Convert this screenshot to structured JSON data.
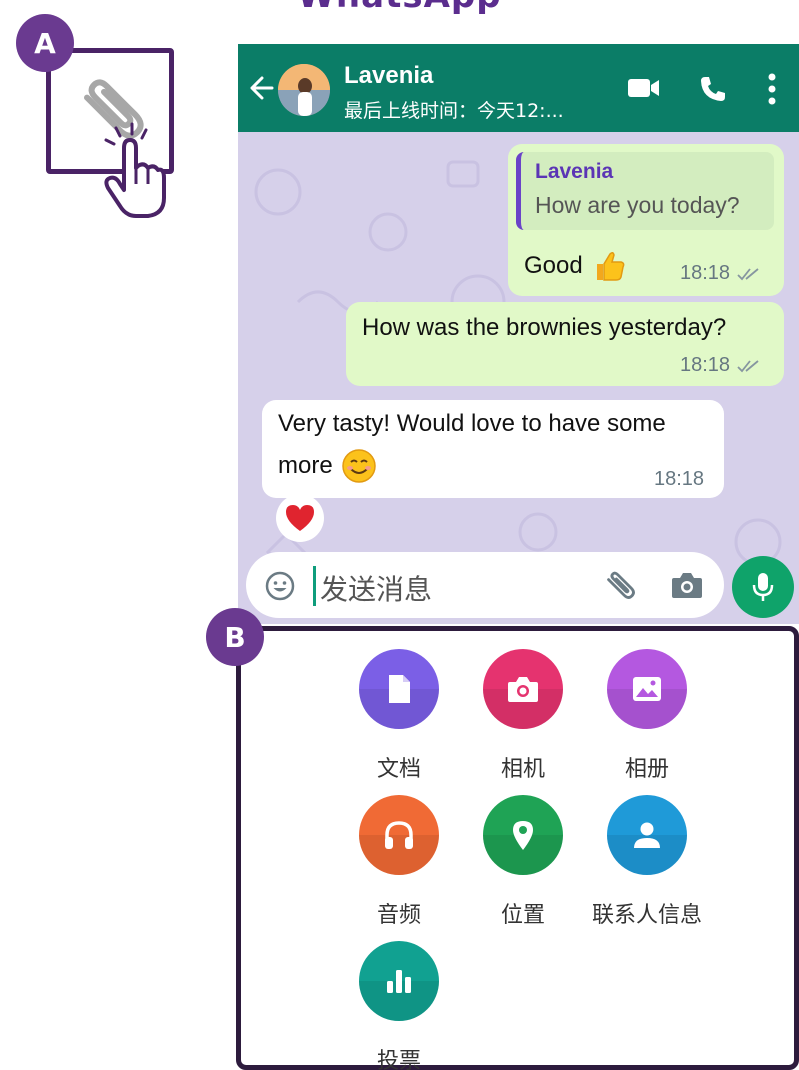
{
  "app_title": "WhatsApp",
  "steps": {
    "a": "A",
    "b": "B"
  },
  "chat": {
    "contact_name": "Lavenia",
    "contact_status": "最后上线时间：今天12:...",
    "messages": [
      {
        "direction": "out",
        "quote_name": "Lavenia",
        "quote_text": "How are you today?",
        "text": "Good",
        "emoji": "thumbs-up",
        "time": "18:18",
        "status": "read"
      },
      {
        "direction": "out",
        "text": "How was the brownies yesterday?",
        "time": "18:18",
        "status": "read"
      },
      {
        "direction": "in",
        "text_line1": "Very tasty! Would love to have some",
        "text_line2": "more",
        "emoji": "smiling-face",
        "time": "18:18",
        "reaction": "red-heart"
      }
    ],
    "input_placeholder": "发送消息"
  },
  "attach_menu": {
    "items": [
      {
        "label": "文档",
        "icon": "document-icon",
        "color": "#7b5fe6"
      },
      {
        "label": "相机",
        "icon": "camera-icon",
        "color": "#e5336f"
      },
      {
        "label": "相册",
        "icon": "gallery-icon",
        "color": "#b458e0"
      },
      {
        "label": "音频",
        "icon": "headphones-icon",
        "color": "#f06a35"
      },
      {
        "label": "位置",
        "icon": "location-pin-icon",
        "color": "#1fa355"
      },
      {
        "label": "联系人信息",
        "icon": "contact-icon",
        "color": "#1f9ad8"
      },
      {
        "label": "投票",
        "icon": "poll-icon",
        "color": "#11a191"
      }
    ]
  }
}
